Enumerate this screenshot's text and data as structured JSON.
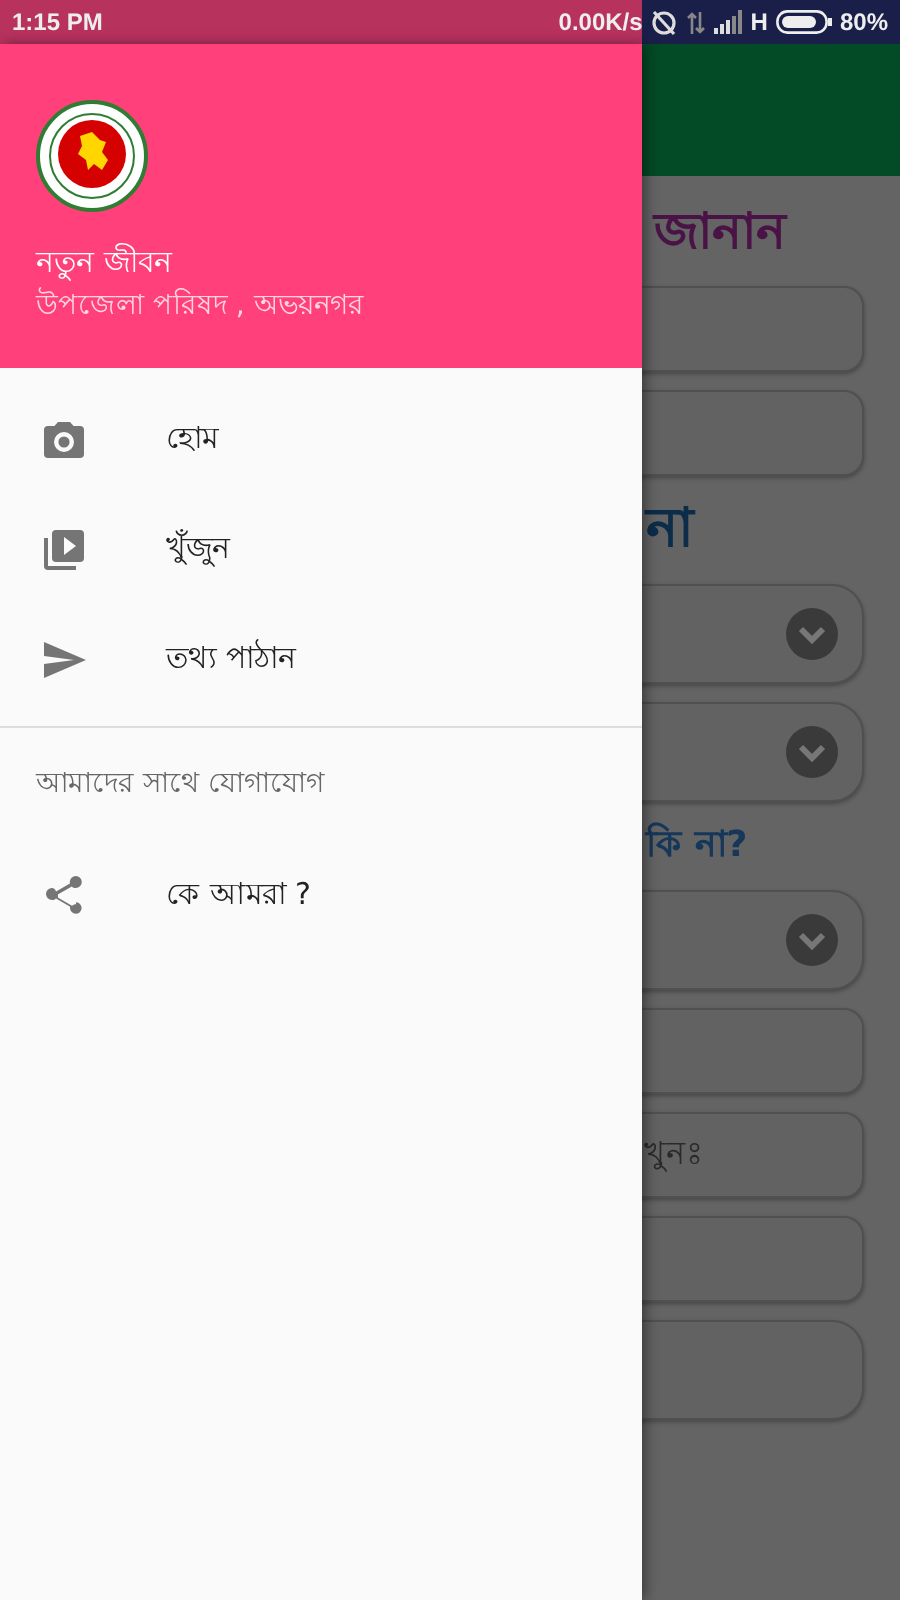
{
  "status_bar": {
    "time": "1:15 PM",
    "speed": "0.00K/s",
    "network": "H",
    "battery": "80%"
  },
  "drawer": {
    "title": "নতুন জীবন",
    "subtitle": "উপজেলা পরিষদ , অভয়নগর",
    "items": [
      {
        "kind": "camera",
        "label": "হোম"
      },
      {
        "kind": "video",
        "label": "খুঁজুন"
      },
      {
        "kind": "send",
        "label": "তথ্য পাঠান"
      }
    ],
    "section": "আমাদের সাথে যোগাযোগ",
    "section_items": [
      {
        "kind": "share",
        "label": "কে আমরা ?"
      }
    ]
  },
  "background": {
    "rows": [
      {
        "kind": "heading",
        "text": "জানান"
      },
      {
        "kind": "field"
      },
      {
        "kind": "field"
      },
      {
        "kind": "heading2",
        "text": "না"
      },
      {
        "kind": "select"
      },
      {
        "kind": "select"
      },
      {
        "kind": "question",
        "text": "কি না?"
      },
      {
        "kind": "select"
      },
      {
        "kind": "field"
      },
      {
        "kind": "field",
        "text": "খুনঃ"
      },
      {
        "kind": "field"
      },
      {
        "kind": "area"
      }
    ]
  }
}
